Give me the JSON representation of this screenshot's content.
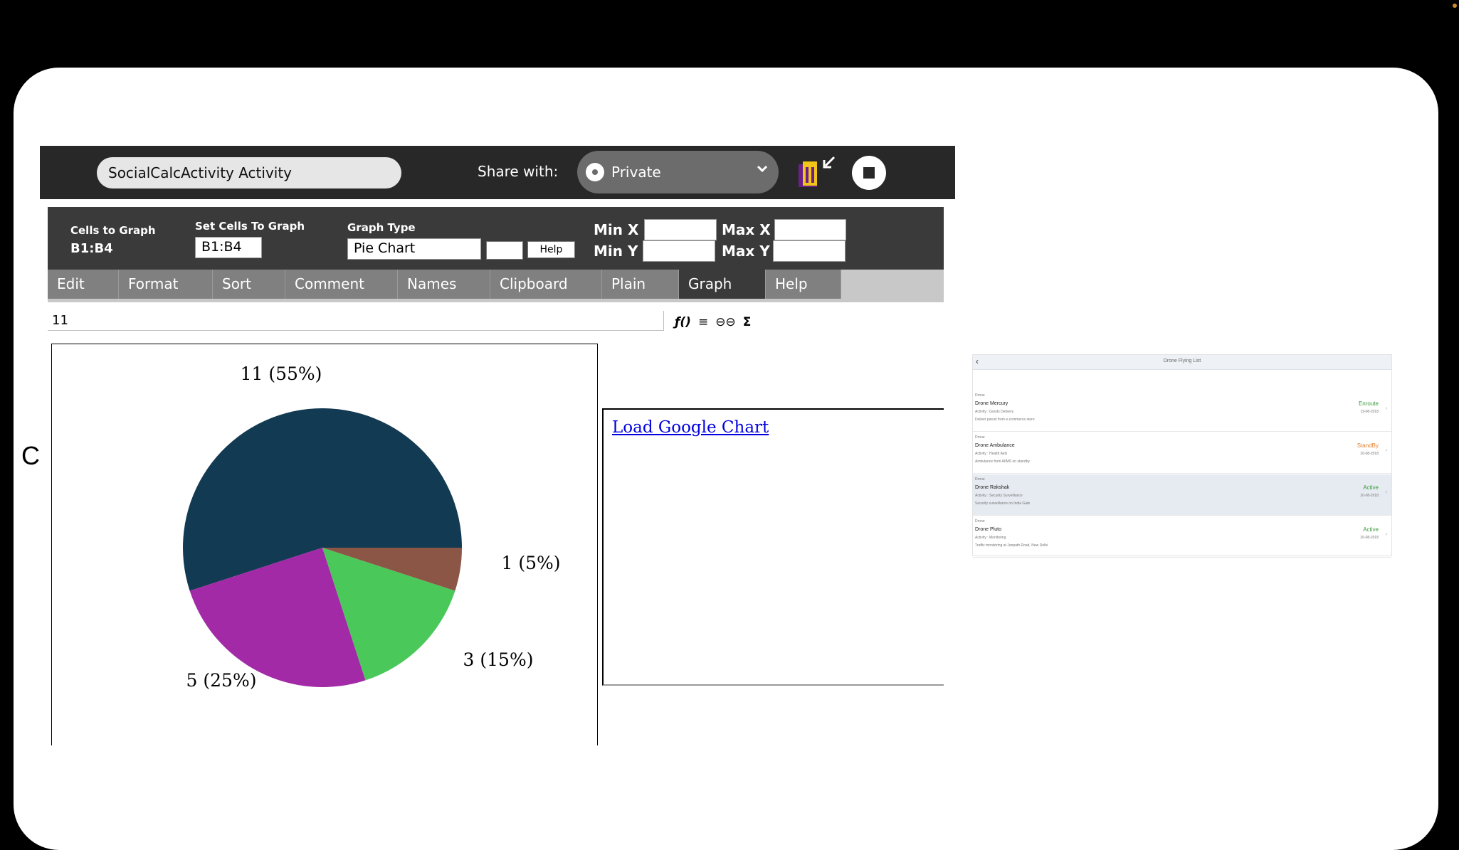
{
  "activity": {
    "title": "SocialCalcActivity Activity",
    "share_label": "Share with:",
    "share_value": "Private"
  },
  "graph_toolbar": {
    "cells_to_graph_label": "Cells to Graph",
    "cells_to_graph_value": "B1:B4",
    "set_cells_label": "Set Cells To Graph",
    "set_cells_value": "B1:B4",
    "graph_type_label": "Graph Type",
    "graph_type_value": "Pie Chart",
    "help_button": "Help",
    "min_x_label": "Min X",
    "max_x_label": "Max X",
    "min_y_label": "Min Y",
    "max_y_label": "Max Y"
  },
  "tabs": [
    "Edit",
    "Format",
    "Sort",
    "Comment",
    "Names",
    "Clipboard",
    "Plain",
    "Graph",
    "Help"
  ],
  "active_tab": "Graph",
  "formula_bar": {
    "value": "11",
    "icons": [
      "function-icon",
      "align-icon",
      "link-icon",
      "sum-icon"
    ],
    "glyphs": [
      "ƒ()",
      "≡",
      "⊖⊖",
      "Σ"
    ]
  },
  "row_label": "C",
  "chart_data": {
    "type": "pie",
    "values": [
      11,
      5,
      3,
      1
    ],
    "labels": [
      "11 (55%)",
      "5 (25%)",
      "3 (15%)",
      "1 (5%)"
    ],
    "colors": [
      "#123a52",
      "#a22aa7",
      "#4ac95a",
      "#8c5646"
    ],
    "start_angle_deg": 0,
    "direction": "counter-clockwise-from-east"
  },
  "google_chart": {
    "link_text": "Load Google Chart"
  },
  "drone_list": {
    "title": "Drone Flying List",
    "items": [
      {
        "category": "Drone",
        "name": "Drone Mercury",
        "activity": "Activity : Goods Delivery",
        "description": "Deliver parcel from e-commerce store",
        "status": "Enroute",
        "status_color": "#3b9a3b",
        "date": "19-08-2018",
        "selected": false
      },
      {
        "category": "Drone",
        "name": "Drone Ambulance",
        "activity": "Activity : Health Aids",
        "description": "Ambulance from AIIMS on standby",
        "status": "StandBy",
        "status_color": "#e8812e",
        "date": "20-08-2018",
        "selected": false
      },
      {
        "category": "Drone",
        "name": "Drone Rakshak",
        "activity": "Activity : Security Surveillance",
        "description": "Security surveillance on India Gate",
        "status": "Active",
        "status_color": "#3b9a3b",
        "date": "20-08-2018",
        "selected": true
      },
      {
        "category": "Drone",
        "name": "Drone Pluto",
        "activity": "Activity : Monitoring",
        "description": "Traffic monitoring at Janpath Road, New Delhi",
        "status": "Active",
        "status_color": "#3b9a3b",
        "date": "20-08-2018",
        "selected": false
      }
    ]
  }
}
